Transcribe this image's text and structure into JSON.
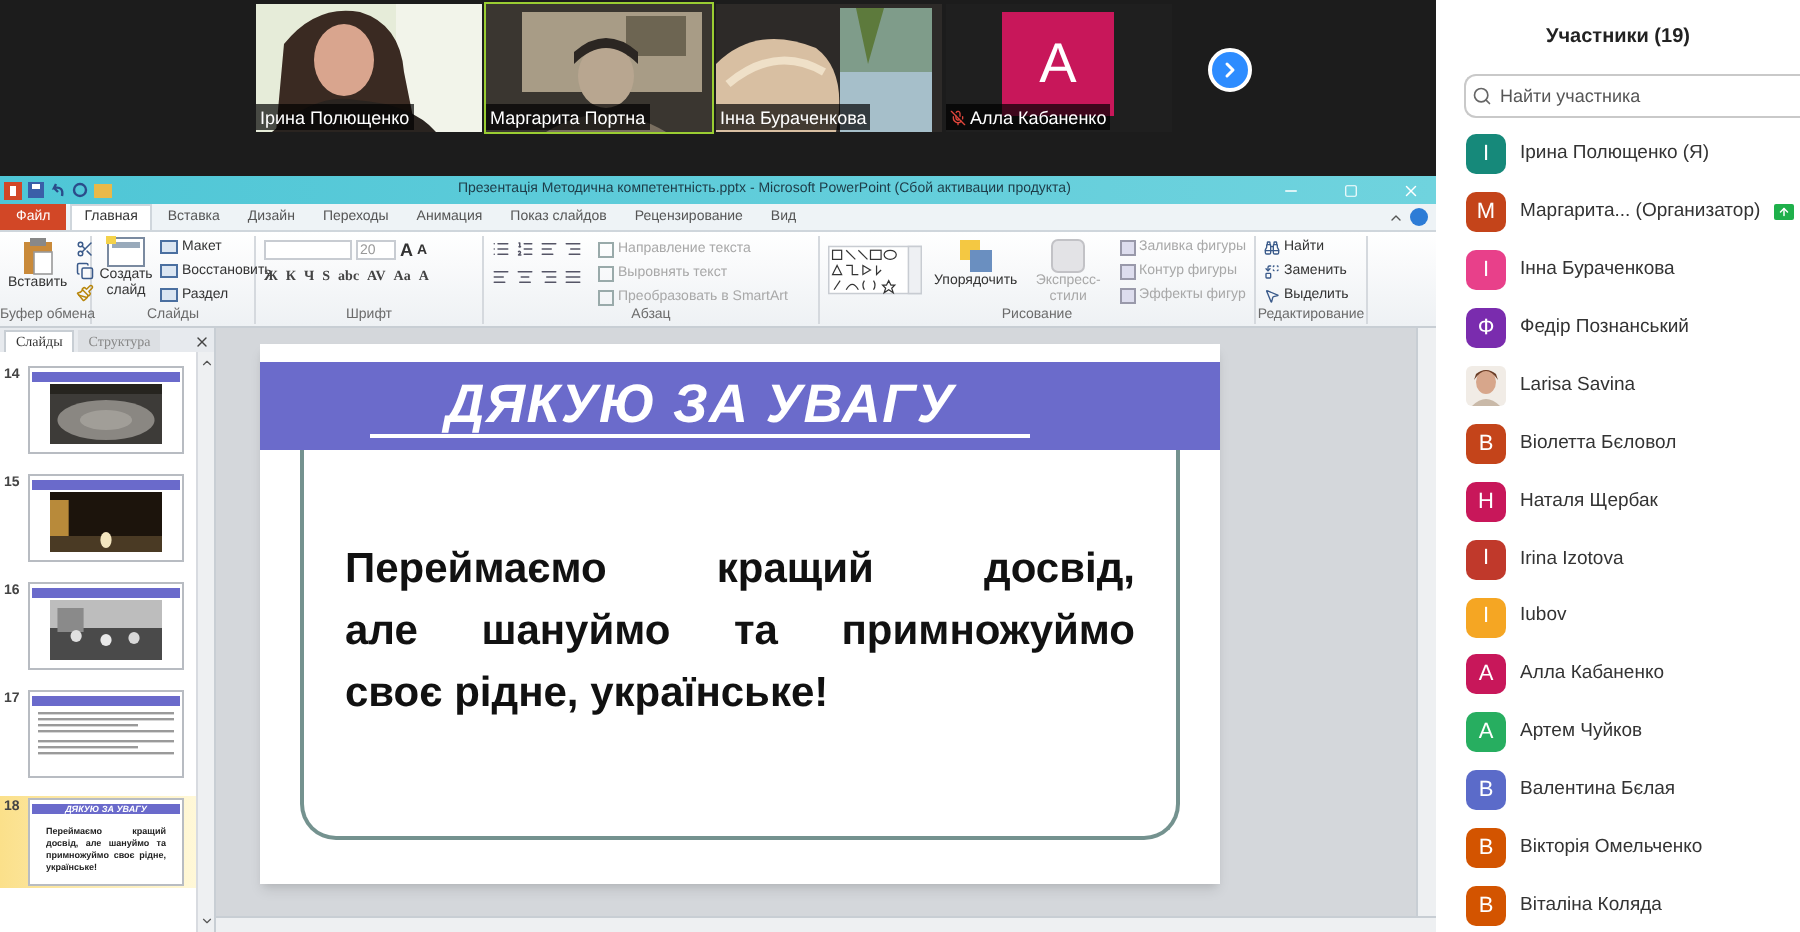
{
  "video_strip": {
    "tiles": [
      {
        "name": "Ірина Полющенко",
        "kind": "video",
        "selected": false,
        "muted": false
      },
      {
        "name": "Маргарита Портна",
        "kind": "video",
        "selected": true,
        "muted": false
      },
      {
        "name": "Інна Бураченкова",
        "kind": "video",
        "selected": false,
        "muted": false
      },
      {
        "name": "Алла Кабаненко",
        "kind": "avatar",
        "initial": "A",
        "color": "#c8175a",
        "selected": false,
        "muted": true
      }
    ]
  },
  "powerpoint": {
    "title": "Презентація Методична компетентність.pptx - Microsoft PowerPoint (Сбой активации продукта)",
    "tabs": [
      {
        "label": "Файл",
        "kind": "file",
        "selected": false
      },
      {
        "label": "Главная",
        "kind": "tab",
        "selected": true
      },
      {
        "label": "Вставка",
        "kind": "tab",
        "selected": false
      },
      {
        "label": "Дизайн",
        "kind": "tab",
        "selected": false
      },
      {
        "label": "Переходы",
        "kind": "tab",
        "selected": false
      },
      {
        "label": "Анимация",
        "kind": "tab",
        "selected": false
      },
      {
        "label": "Показ слайдов",
        "kind": "tab",
        "selected": false
      },
      {
        "label": "Рецензирование",
        "kind": "tab",
        "selected": false
      },
      {
        "label": "Вид",
        "kind": "tab",
        "selected": false
      }
    ],
    "ribbon": [
      {
        "kind": "clipboard",
        "label": "Буфер обмена",
        "paste": "Вставить"
      },
      {
        "kind": "slides",
        "label": "Слайды",
        "new_slide": "Создать слайд",
        "items": [
          "Макет",
          "Восстановить",
          "Раздел"
        ]
      },
      {
        "kind": "font",
        "label": "Шрифт",
        "size": "20",
        "size_buttons": [
          "A",
          "A"
        ],
        "glyphs": [
          "Ж",
          "К",
          "Ч",
          "S",
          "abc",
          "AV",
          "Aa",
          "A"
        ]
      },
      {
        "kind": "paragraph",
        "label": "Абзац",
        "items": [
          {
            "label": "Направление текста",
            "disabled": true
          },
          {
            "label": "Выровнять текст",
            "disabled": true
          },
          {
            "label": "Преобразовать в SmartArt",
            "disabled": true
          }
        ]
      },
      {
        "kind": "drawing",
        "label": "Рисование",
        "arrange": "Упорядочить",
        "quick_styles": "Экспресс-стили",
        "items": [
          {
            "label": "Заливка фигуры",
            "disabled": true
          },
          {
            "label": "Контур фигуры",
            "disabled": true
          },
          {
            "label": "Эффекты фигур",
            "disabled": true
          }
        ]
      },
      {
        "kind": "editing",
        "label": "Редактирование",
        "items": [
          {
            "label": "Найти",
            "disabled": false
          },
          {
            "label": "Заменить",
            "disabled": false
          },
          {
            "label": "Выделить",
            "disabled": false
          }
        ]
      }
    ],
    "panel_tabs": [
      {
        "label": "Слайды",
        "selected": true
      },
      {
        "label": "Структура",
        "selected": false
      }
    ],
    "thumbnails": [
      {
        "number": "14",
        "selected": false
      },
      {
        "number": "15",
        "selected": false
      },
      {
        "number": "16",
        "selected": false
      },
      {
        "number": "17",
        "kind": "text",
        "selected": false
      },
      {
        "number": "18",
        "kind": "final",
        "selected": true,
        "title": "ДЯКУЮ ЗА УВАГУ",
        "body": "Переймаємо кращий досвід, але шануймо та примножуймо своє рідне, українське!"
      }
    ],
    "slide": {
      "title": "ДЯКУЮ ЗА УВАГУ",
      "body_lines": [
        "Переймаємо  кращий  досвід,",
        "але  шануймо  та  примножуймо",
        "своє рідне, українське!"
      ]
    }
  },
  "participants": {
    "title": "Участники (19)",
    "search": {
      "placeholder": "Найти участника"
    },
    "items": [
      {
        "name": "Ірина Полющенко (Я)",
        "kind": "letter",
        "initial": "І",
        "color": "#16897a",
        "sharing": false
      },
      {
        "name": "Маргарита... (Организатор)",
        "kind": "letter",
        "initial": "М",
        "color": "#c4441a",
        "sharing": true
      },
      {
        "name": "Інна Бураченкова",
        "kind": "letter",
        "initial": "І",
        "color": "#e8408a",
        "sharing": false
      },
      {
        "name": "Федір Познанський",
        "kind": "letter",
        "initial": "Ф",
        "color": "#7a2cae",
        "sharing": false
      },
      {
        "name": "Larisa Savina",
        "sharing": false
      },
      {
        "name": "Віолетта Бєловол",
        "kind": "letter",
        "initial": "В",
        "color": "#c4441a",
        "sharing": false
      },
      {
        "name": "Наталя Щербак",
        "kind": "letter",
        "initial": "Н",
        "color": "#c8175a",
        "sharing": false
      },
      {
        "name": "Irina Izotova",
        "kind": "letter",
        "initial": "I",
        "color": "#c0392b",
        "sharing": false
      },
      {
        "name": "Iubov",
        "kind": "letter",
        "initial": "I",
        "color": "#f5a623",
        "sharing": false
      },
      {
        "name": "Алла Кабаненко",
        "kind": "letter",
        "initial": "А",
        "color": "#c8175a",
        "sharing": false
      },
      {
        "name": "Артем Чуйков",
        "kind": "letter",
        "initial": "А",
        "color": "#27ae60",
        "sharing": false
      },
      {
        "name": "Валентина Бєлая",
        "kind": "letter",
        "initial": "В",
        "color": "#5b6bc9",
        "sharing": false
      },
      {
        "name": "Вікторія Омельченко",
        "kind": "letter",
        "initial": "В",
        "color": "#d35400",
        "sharing": false
      },
      {
        "name": "Віталіна Коляда",
        "kind": "letter",
        "initial": "В",
        "color": "#d35400",
        "sharing": false
      }
    ]
  }
}
